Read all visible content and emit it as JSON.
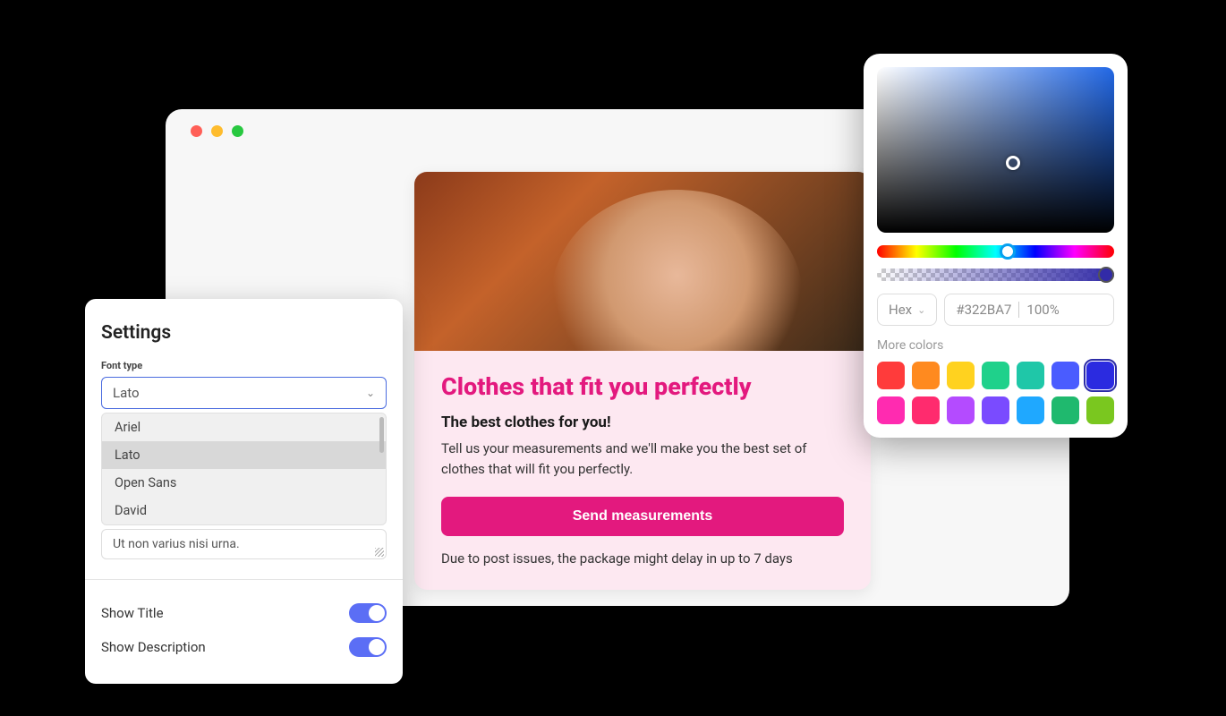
{
  "browser": {
    "traffic_lights": [
      "red",
      "yellow",
      "green"
    ]
  },
  "card": {
    "title": "Clothes that fit you perfectly",
    "subtitle": "The best clothes for you!",
    "text": "Tell us your measurements and we'll make you the best set of clothes that will fit you perfectly.",
    "cta_label": "Send measurements",
    "footnote": "Due to post issues, the package might delay in up to 7 days"
  },
  "settings": {
    "title": "Settings",
    "font_type_label": "Font type",
    "font_selected": "Lato",
    "font_options": [
      "Ariel",
      "Lato",
      "Open Sans",
      "David"
    ],
    "textarea_value": "Ut non varius nisi urna.",
    "toggles": [
      {
        "label": "Show Title",
        "value": true
      },
      {
        "label": "Show Description",
        "value": true
      }
    ]
  },
  "color_picker": {
    "format": "Hex",
    "hex_value": "#322BA7",
    "alpha": "100%",
    "more_colors_label": "More colors",
    "swatches": [
      "#ff3b3b",
      "#ff8a1f",
      "#ffd21f",
      "#1fd18b",
      "#1fc7a8",
      "#4a5cff",
      "#2b2be0",
      "#ff2bb0",
      "#ff2b6e",
      "#b44bff",
      "#7a4bff",
      "#1fa8ff",
      "#1fb96e",
      "#7ac71f"
    ],
    "selected_swatch_index": 6
  }
}
